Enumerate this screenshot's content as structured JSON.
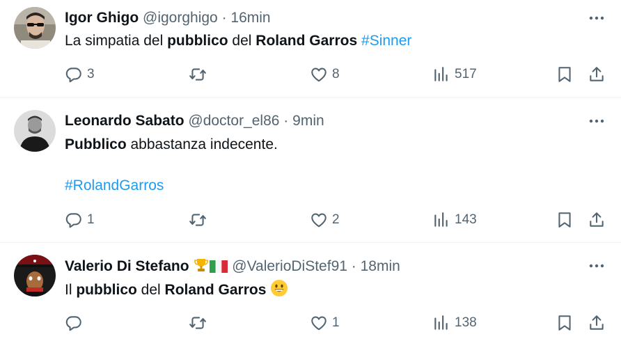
{
  "tweets": [
    {
      "name": "Igor Ghigo",
      "handle": "@igorghigo",
      "sep": "·",
      "time": "16min",
      "text_parts": [
        "La simpatia del ",
        "pubblico",
        " del ",
        "Roland Garros",
        " ",
        "#Sinner"
      ],
      "replies": "3",
      "retweets": "",
      "likes": "8",
      "views": "517"
    },
    {
      "name": "Leonardo Sabato",
      "handle": "@doctor_el86",
      "sep": "·",
      "time": "9min",
      "text_parts": [
        "Pubblico",
        " abbastanza indecente."
      ],
      "hashtag": "#RolandGarros",
      "replies": "1",
      "retweets": "",
      "likes": "2",
      "views": "143"
    },
    {
      "name": "Valerio Di Stefano",
      "handle": "@ValerioDiStef91",
      "sep": "·",
      "time": "18min",
      "text_parts": [
        "Il ",
        "pubblico",
        " del ",
        "Roland Garros"
      ],
      "replies": "",
      "retweets": "",
      "likes": "1",
      "views": "138"
    }
  ],
  "colors": {
    "text": "#0f1419",
    "muted": "#536471",
    "link": "#1d9bf0",
    "divider": "#eff3f4"
  },
  "icons": [
    "more-icon",
    "reply-icon",
    "retweet-icon",
    "like-icon",
    "views-icon",
    "bookmark-icon",
    "share-icon",
    "trophy-icon",
    "italy-flag-icon",
    "grinning-emoji-icon"
  ]
}
